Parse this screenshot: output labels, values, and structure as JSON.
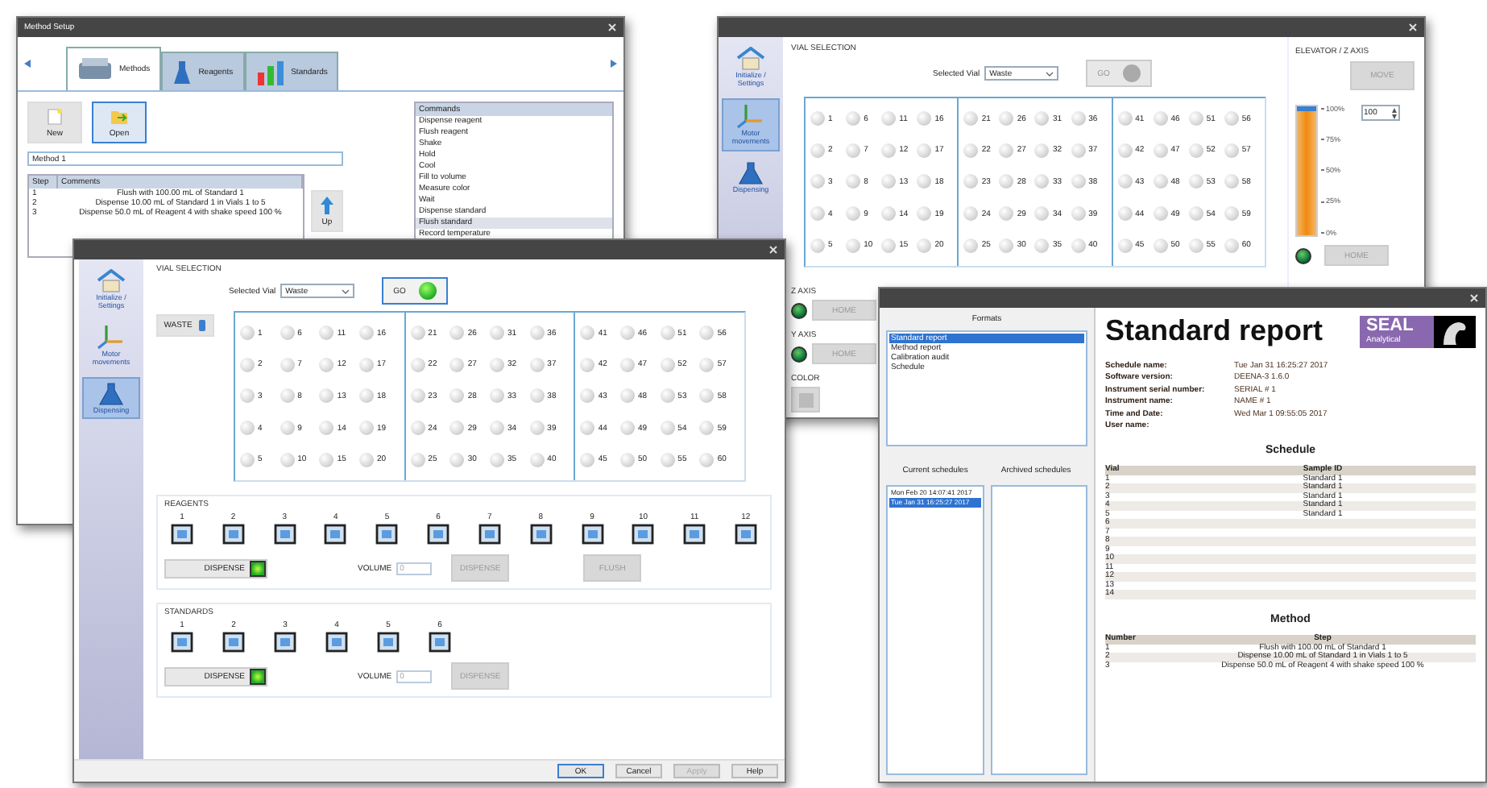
{
  "method_setup": {
    "title": "Method Setup",
    "tabs": [
      {
        "label": "Methods",
        "selected": true
      },
      {
        "label": "Reagents",
        "selected": false
      },
      {
        "label": "Standards",
        "selected": false
      }
    ],
    "tool_buttons": [
      {
        "label": "New",
        "selected": false
      },
      {
        "label": "Open",
        "selected": true
      }
    ],
    "method_name": "Method 1",
    "steps": {
      "columns": [
        "Step",
        "Comments"
      ],
      "rows": [
        [
          "1",
          "Flush with 100.00 mL of Standard 1"
        ],
        [
          "2",
          "Dispense 10.00 mL of Standard 1 in Vials 1 to 5"
        ],
        [
          "3",
          "Dispense 50.0 mL of Reagent 4 with shake speed 100 %"
        ]
      ]
    },
    "up_button": "Up",
    "commands": {
      "header": "Commands",
      "items": [
        {
          "label": "Dispense reagent",
          "selected": false
        },
        {
          "label": "Flush reagent",
          "selected": false
        },
        {
          "label": "Shake",
          "selected": false
        },
        {
          "label": "Hold",
          "selected": false
        },
        {
          "label": "Cool",
          "selected": false
        },
        {
          "label": "Fill to volume",
          "selected": false
        },
        {
          "label": "Measure color",
          "selected": false
        },
        {
          "label": "Wait",
          "selected": false
        },
        {
          "label": "Dispense standard",
          "selected": false
        },
        {
          "label": "Flush standard",
          "selected": true
        },
        {
          "label": "Record temperature",
          "selected": false
        }
      ]
    }
  },
  "motor_window": {
    "sidebar": [
      {
        "label": "Initialize / Settings",
        "selected": false
      },
      {
        "label": "Motor movements",
        "selected": true
      },
      {
        "label": "Dispensing",
        "selected": false
      }
    ],
    "vial_section": "VIAL SELECTION",
    "selected_vial_label": "Selected Vial",
    "selected_vial": "Waste",
    "go_button": {
      "label": "GO",
      "disabled": true
    },
    "vials": [
      "1",
      "2",
      "3",
      "4",
      "5",
      "6",
      "7",
      "8",
      "9",
      "10",
      "11",
      "12",
      "13",
      "14",
      "15",
      "16",
      "17",
      "18",
      "19",
      "20",
      "21",
      "22",
      "23",
      "24",
      "25",
      "26",
      "27",
      "28",
      "29",
      "30",
      "31",
      "32",
      "33",
      "34",
      "35",
      "36",
      "37",
      "38",
      "39",
      "40",
      "41",
      "42",
      "43",
      "44",
      "45",
      "46",
      "47",
      "48",
      "49",
      "50",
      "51",
      "52",
      "53",
      "54",
      "55",
      "56",
      "57",
      "58",
      "59",
      "60"
    ],
    "axes": [
      {
        "label": "Z AXIS",
        "led_on": true,
        "button": "HOME"
      },
      {
        "label": "Y AXIS",
        "led_on": true,
        "button": "HOME"
      }
    ],
    "color_label": "COLOR",
    "elevator": {
      "title": "ELEVATOR / Z AXIS",
      "move_button": "MOVE",
      "level": 1,
      "ticks": [
        "100%",
        "75%",
        "50%",
        "25%",
        "0%"
      ],
      "spin_value": "100",
      "led_on": true,
      "home_button": "HOME"
    }
  },
  "dispensing_window": {
    "sidebar": [
      {
        "label": "Initialize / Settings",
        "selected": false
      },
      {
        "label": "Motor movements",
        "selected": false
      },
      {
        "label": "Dispensing",
        "selected": true
      }
    ],
    "vial_section": "VIAL SELECTION",
    "selected_vial_label": "Selected Vial",
    "selected_vial": "Waste",
    "go_button": {
      "label": "GO",
      "disabled": false
    },
    "waste_button": "WASTE",
    "vials": [
      "1",
      "2",
      "3",
      "4",
      "5",
      "6",
      "7",
      "8",
      "9",
      "10",
      "11",
      "12",
      "13",
      "14",
      "15",
      "16",
      "17",
      "18",
      "19",
      "20",
      "21",
      "22",
      "23",
      "24",
      "25",
      "26",
      "27",
      "28",
      "29",
      "30",
      "31",
      "32",
      "33",
      "34",
      "35",
      "36",
      "37",
      "38",
      "39",
      "40",
      "41",
      "42",
      "43",
      "44",
      "45",
      "46",
      "47",
      "48",
      "49",
      "50",
      "51",
      "52",
      "53",
      "54",
      "55",
      "56",
      "57",
      "58",
      "59",
      "60"
    ],
    "reagents": {
      "title": "REAGENTS",
      "numbers": [
        "1",
        "2",
        "3",
        "4",
        "5",
        "6",
        "7",
        "8",
        "9",
        "10",
        "11",
        "12"
      ],
      "dispense_button": {
        "label": "DISPENSE",
        "on": true
      },
      "volume_label": "VOLUME",
      "volume": "0",
      "actions": [
        {
          "label": "DISPENSE",
          "disabled": true
        },
        {
          "label": "FLUSH",
          "disabled": true
        }
      ]
    },
    "standards": {
      "title": "STANDARDS",
      "numbers": [
        "1",
        "2",
        "3",
        "4",
        "5",
        "6"
      ],
      "dispense_button": {
        "label": "DISPENSE",
        "on": true
      },
      "volume_label": "VOLUME",
      "volume": "0",
      "actions": [
        {
          "label": "DISPENSE",
          "disabled": true
        }
      ]
    },
    "footer_buttons": [
      {
        "label": "OK",
        "disabled": false
      },
      {
        "label": "Cancel",
        "disabled": false
      },
      {
        "label": "Apply",
        "disabled": true
      },
      {
        "label": "Help",
        "disabled": false
      }
    ]
  },
  "report_window": {
    "formats_label": "Formats",
    "formats": [
      {
        "label": "Standard report",
        "selected": true
      },
      {
        "label": "Method report",
        "selected": false
      },
      {
        "label": "Calibration audit",
        "selected": false
      },
      {
        "label": "Schedule",
        "selected": false
      }
    ],
    "current_schedules_label": "Current schedules",
    "archived_schedules_label": "Archived schedules",
    "current_schedules": [
      {
        "label": "Mon Feb 20 14:07:41 2017",
        "selected": false
      },
      {
        "label": "Tue Jan 31 16:25:27 2017",
        "selected": true
      }
    ],
    "report": {
      "title": "Standard report",
      "logo": {
        "line1": "SEAL",
        "line2": "Analytical"
      },
      "info": [
        {
          "label": "Schedule name:",
          "value": "Tue Jan 31 16:25:27 2017"
        },
        {
          "label": "Software version:",
          "value": "DEENA-3 1.6.0"
        },
        {
          "label": "Instrument serial number:",
          "value": "SERIAL # 1"
        },
        {
          "label": "Instrument name:",
          "value": "NAME # 1"
        },
        {
          "label": "Time and Date:",
          "value": "Wed Mar 1 09:55:05 2017"
        },
        {
          "label": "User name:"
        }
      ],
      "schedule": {
        "heading": "Schedule",
        "columns": [
          "Vial",
          "Sample ID"
        ],
        "rows": [
          [
            "1",
            "Standard 1"
          ],
          [
            "2",
            "Standard 1"
          ],
          [
            "3",
            "Standard 1"
          ],
          [
            "4",
            "Standard 1"
          ],
          [
            "5",
            "Standard 1"
          ],
          [
            "6"
          ],
          [
            "7"
          ],
          [
            "8"
          ],
          [
            "9"
          ],
          [
            "10"
          ],
          [
            "11"
          ],
          [
            "12"
          ],
          [
            "13"
          ],
          [
            "14"
          ]
        ]
      },
      "method": {
        "heading": "Method",
        "columns": [
          "Number",
          "Step"
        ],
        "rows": [
          [
            "1",
            "Flush with 100.00 mL of Standard 1"
          ],
          [
            "2",
            "Dispense 10.00 mL of Standard 1 in Vials 1 to 5"
          ],
          [
            "3",
            "Dispense 50.0 mL of Reagent 4 with shake speed 100 %"
          ]
        ]
      }
    }
  }
}
